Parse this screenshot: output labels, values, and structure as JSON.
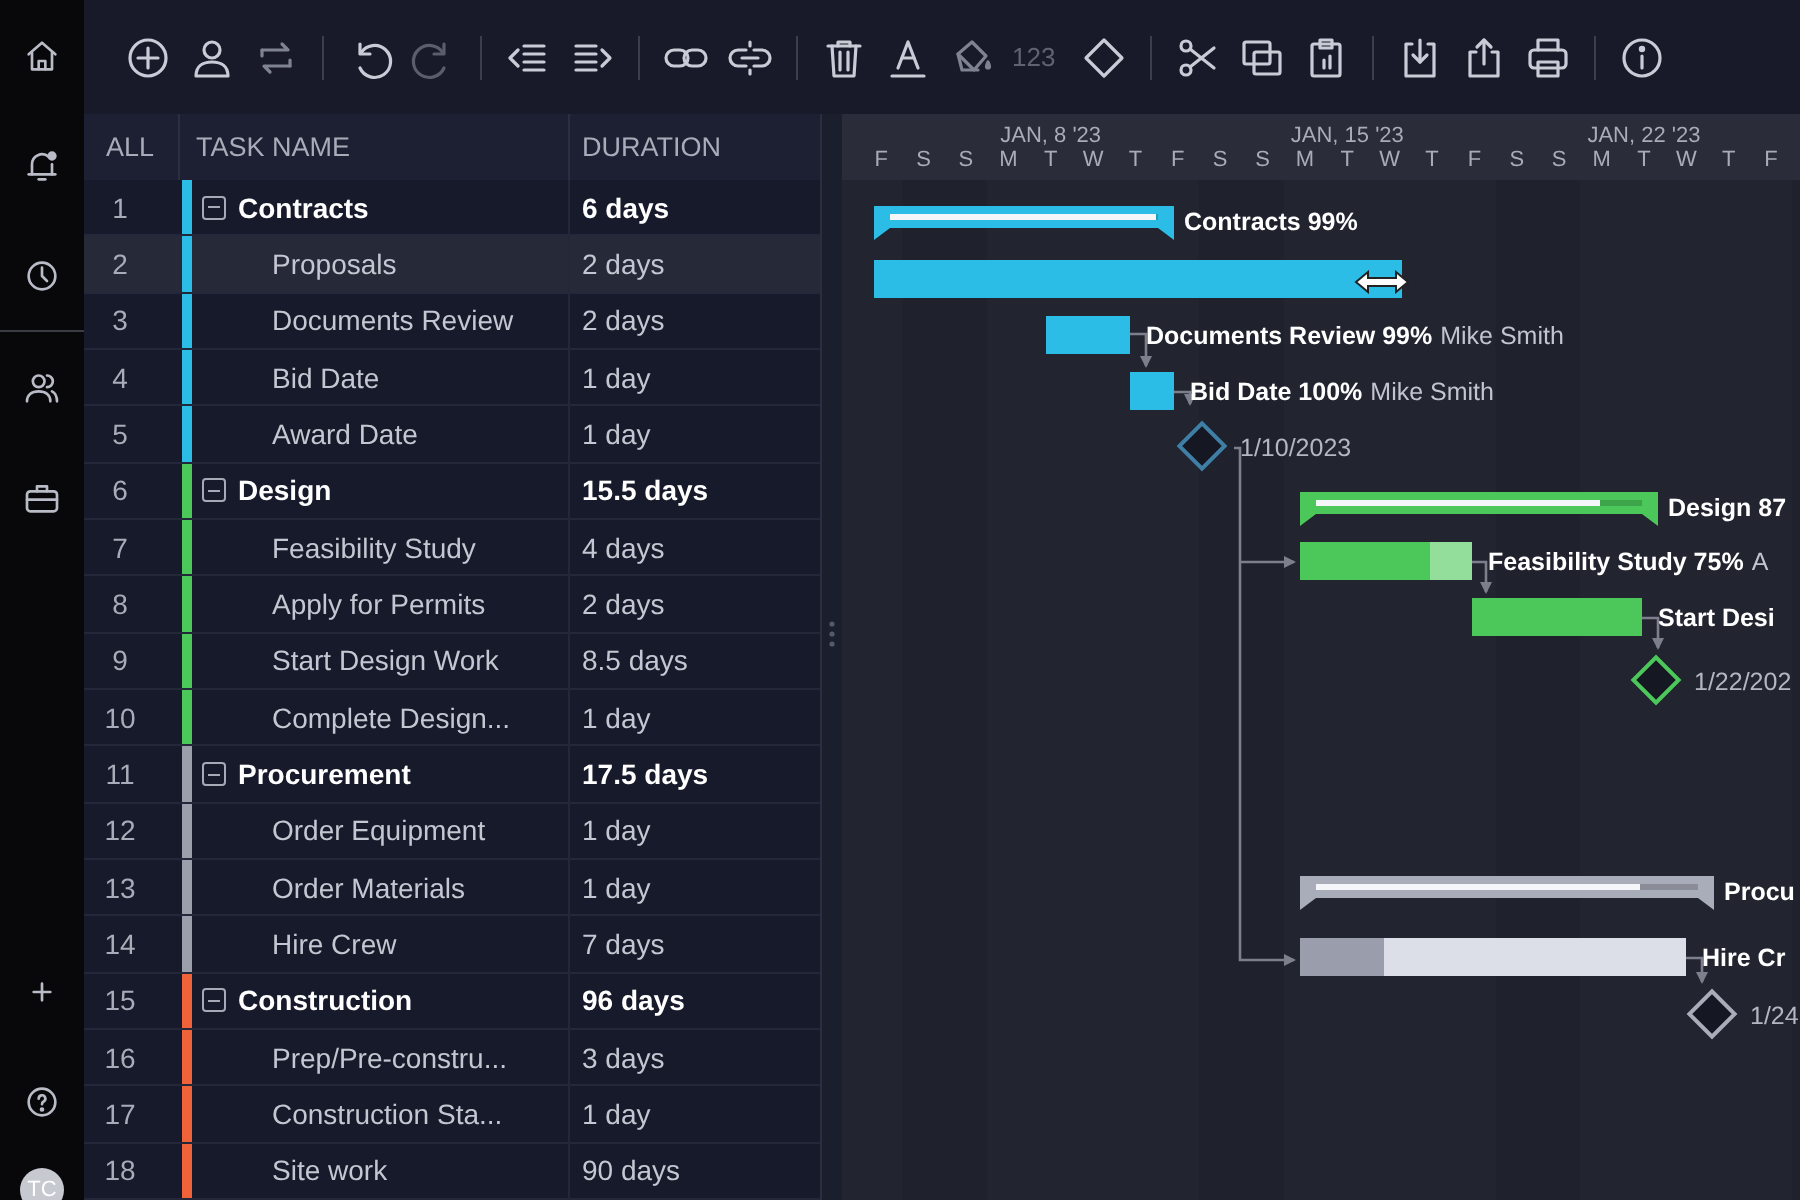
{
  "toolbar": {
    "redo_disabled": true,
    "number_format_label": "123"
  },
  "user": {
    "initials": "TC"
  },
  "table": {
    "columns": [
      "ALL",
      "TASK NAME",
      "DURATION"
    ],
    "groups": [
      {
        "num": "1",
        "name": "Contracts",
        "duration": "6 days",
        "color": "#2bbde6",
        "expanded": true,
        "selected": false,
        "children": [
          {
            "num": "2",
            "name": "Proposals",
            "duration": "2 days",
            "selected": true
          },
          {
            "num": "3",
            "name": "Documents Review",
            "duration": "2 days",
            "selected": false
          },
          {
            "num": "4",
            "name": "Bid Date",
            "duration": "1 day",
            "selected": false
          },
          {
            "num": "5",
            "name": "Award Date",
            "duration": "1 day",
            "selected": false
          }
        ]
      },
      {
        "num": "6",
        "name": "Design",
        "duration": "15.5 days",
        "color": "#4cc85a",
        "expanded": true,
        "selected": false,
        "children": [
          {
            "num": "7",
            "name": "Feasibility Study",
            "duration": "4 days",
            "selected": false
          },
          {
            "num": "8",
            "name": "Apply for Permits",
            "duration": "2 days",
            "selected": false
          },
          {
            "num": "9",
            "name": "Start Design Work",
            "duration": "8.5 days",
            "selected": false
          },
          {
            "num": "10",
            "name": "Complete Design...",
            "duration": "1 day",
            "selected": false
          }
        ]
      },
      {
        "num": "11",
        "name": "Procurement",
        "duration": "17.5 days",
        "color": "#9b9eab",
        "expanded": true,
        "selected": false,
        "children": [
          {
            "num": "12",
            "name": "Order Equipment",
            "duration": "1 day",
            "selected": false
          },
          {
            "num": "13",
            "name": "Order Materials",
            "duration": "1 day",
            "selected": false
          },
          {
            "num": "14",
            "name": "Hire Crew",
            "duration": "7 days",
            "selected": false
          }
        ]
      },
      {
        "num": "15",
        "name": "Construction",
        "duration": "96 days",
        "color": "#f0623a",
        "expanded": true,
        "selected": false,
        "children": [
          {
            "num": "16",
            "name": "Prep/Pre-constru...",
            "duration": "3 days",
            "selected": false
          },
          {
            "num": "17",
            "name": "Construction Sta...",
            "duration": "1 day",
            "selected": false
          },
          {
            "num": "18",
            "name": "Site work",
            "duration": "90 days",
            "selected": false
          }
        ]
      }
    ]
  },
  "gantt": {
    "weeks": [
      "JAN, 8 '23",
      "JAN, 15 '23",
      "JAN, 22 '23"
    ],
    "days": [
      "F",
      "S",
      "S",
      "M",
      "T",
      "W",
      "T",
      "F",
      "S",
      "S",
      "M",
      "T",
      "W",
      "T",
      "F",
      "S",
      "S",
      "M",
      "T",
      "W",
      "T",
      "F"
    ],
    "bars": [
      {
        "kind": "summary",
        "label": "Contracts 99%",
        "color": "#2bbde6",
        "level": 0.99
      },
      {
        "kind": "task",
        "color": "#2bbde6",
        "level": 1
      },
      {
        "kind": "task",
        "label": "Documents Review 99%",
        "assignee": "Mike Smith",
        "color": "#2bbde6",
        "level": 0.99
      },
      {
        "kind": "task",
        "label": "Bid Date 100%",
        "assignee": "Mike Smith",
        "color": "#2bbde6",
        "level": 1
      },
      {
        "kind": "milestone",
        "label": "1/10/2023",
        "color": "#3f7fa6"
      },
      {
        "kind": "summary",
        "label": "Design 87",
        "color": "#4cc85a",
        "level": 0.87
      },
      {
        "kind": "task",
        "label": "Feasibility Study 75%",
        "assignee": "A",
        "color": "#4cc85a",
        "level": 0.75
      },
      {
        "kind": "task",
        "label": "Start Desi",
        "color": "#4cc85a",
        "level": 1
      },
      {
        "kind": "milestone",
        "label": "1/22/202",
        "color": "#4cc85a"
      },
      {
        "kind": "summary",
        "label": "Procu",
        "color": "#a9acb9",
        "level": 0.85
      },
      {
        "kind": "task",
        "label": "Hire Cr",
        "color": "#dcdee8",
        "level": 0.22
      },
      {
        "kind": "milestone",
        "label": "1/24",
        "color": "#a9acb9"
      }
    ]
  }
}
